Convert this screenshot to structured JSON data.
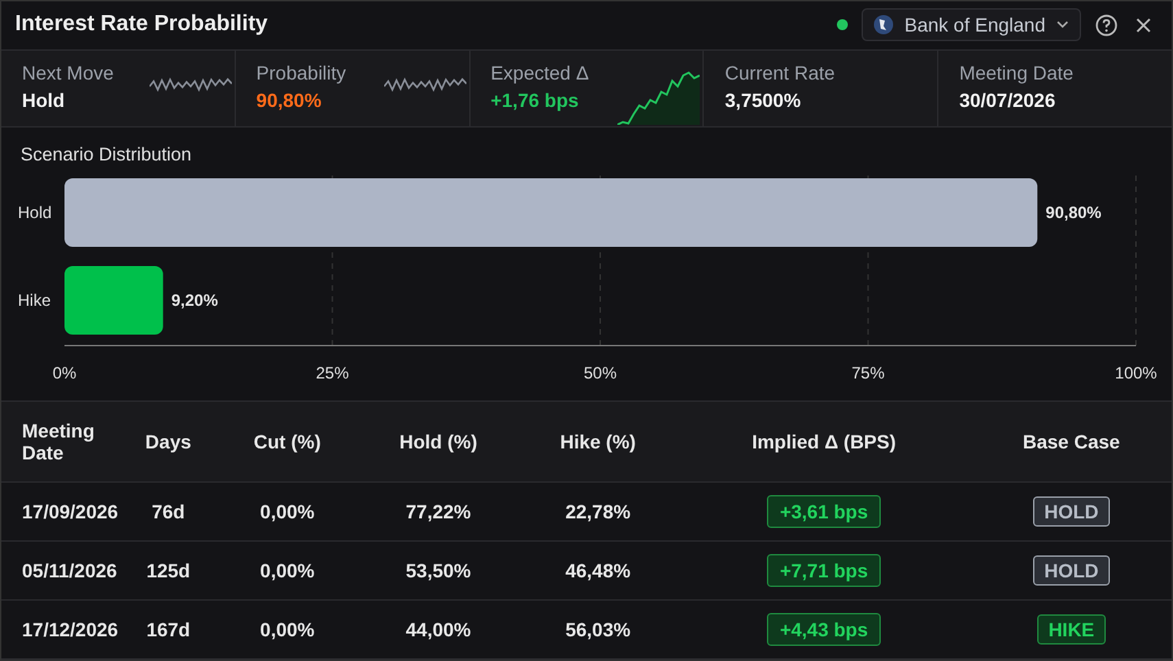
{
  "window": {
    "title": "Interest Rate Probability",
    "connected": true,
    "bank": "Bank of England"
  },
  "stats": [
    {
      "label": "Next Move",
      "value": "Hold",
      "kind": "plain",
      "sparkline": true,
      "rising": false
    },
    {
      "label": "Probability",
      "value": "90,80%",
      "kind": "warning",
      "sparkline": true,
      "rising": false
    },
    {
      "label": "Expected Δ",
      "value": "+1,76 bps",
      "kind": "positive",
      "sparkline": true,
      "rising": true
    },
    {
      "label": "Current Rate",
      "value": "3,7500%",
      "kind": "plain"
    },
    {
      "label": "Meeting Date",
      "value": "30/07/2026",
      "kind": "plain"
    }
  ],
  "distribution": {
    "title": "Scenario Distribution",
    "chart_data": {
      "type": "bar",
      "orientation": "horizontal",
      "categories": [
        "Hold",
        "Hike"
      ],
      "series": [
        {
          "color": "#adb5c6",
          "values": [
            90.8,
            null
          ]
        },
        {
          "color": "#00c04b",
          "values": [
            null,
            9.2
          ]
        }
      ],
      "grid": true,
      "xlim": [
        0,
        100
      ],
      "xticks": [
        {
          "value": 0,
          "label": "0%"
        },
        {
          "value": 25,
          "label": "25%"
        },
        {
          "value": 50,
          "label": "50%"
        },
        {
          "value": 75,
          "label": "75%"
        },
        {
          "value": 100,
          "label": "100%"
        }
      ],
      "value_labels": [
        "90,80%",
        "9,20%"
      ]
    }
  },
  "table": {
    "columns": [
      "Meeting Date",
      "Days",
      "Cut (%)",
      "Hold (%)",
      "Hike (%)",
      "Implied Δ (BPS)",
      "Base Case"
    ],
    "rows": [
      {
        "date": "17/09/2026",
        "days": "76d",
        "cut": "0,00%",
        "hold": "77,22%",
        "hike": "22,78%",
        "implied": "+3,61 bps",
        "base": {
          "label": "HOLD",
          "kind": "hold"
        }
      },
      {
        "date": "05/11/2026",
        "days": "125d",
        "cut": "0,00%",
        "hold": "53,50%",
        "hike": "46,48%",
        "implied": "+7,71 bps",
        "base": {
          "label": "HOLD",
          "kind": "hold"
        }
      },
      {
        "date": "17/12/2026",
        "days": "167d",
        "cut": "0,00%",
        "hold": "44,00%",
        "hike": "56,03%",
        "implied": "+4,43 bps",
        "base": {
          "label": "HIKE",
          "kind": "hike"
        }
      }
    ]
  }
}
